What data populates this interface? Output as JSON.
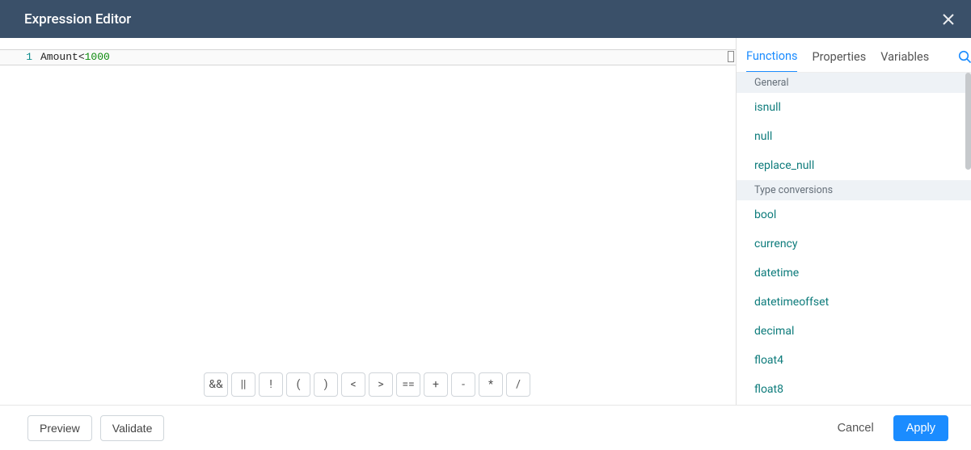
{
  "title": "Expression Editor",
  "code": {
    "line_no": "1",
    "identifier": "Amount",
    "operator": "<",
    "number": "1000"
  },
  "operators": [
    "&&",
    "||",
    "!",
    "(",
    ")",
    "<",
    ">",
    "==",
    "+",
    "-",
    "*",
    "/"
  ],
  "tabs": {
    "functions": "Functions",
    "properties": "Properties",
    "variables": "Variables"
  },
  "groups": [
    {
      "header": "General",
      "items": [
        "isnull",
        "null",
        "replace_null"
      ]
    },
    {
      "header": "Type conversions",
      "items": [
        "bool",
        "currency",
        "datetime",
        "datetimeoffset",
        "decimal",
        "float4",
        "float8"
      ]
    }
  ],
  "footer": {
    "preview": "Preview",
    "validate": "Validate",
    "cancel": "Cancel",
    "apply": "Apply"
  }
}
